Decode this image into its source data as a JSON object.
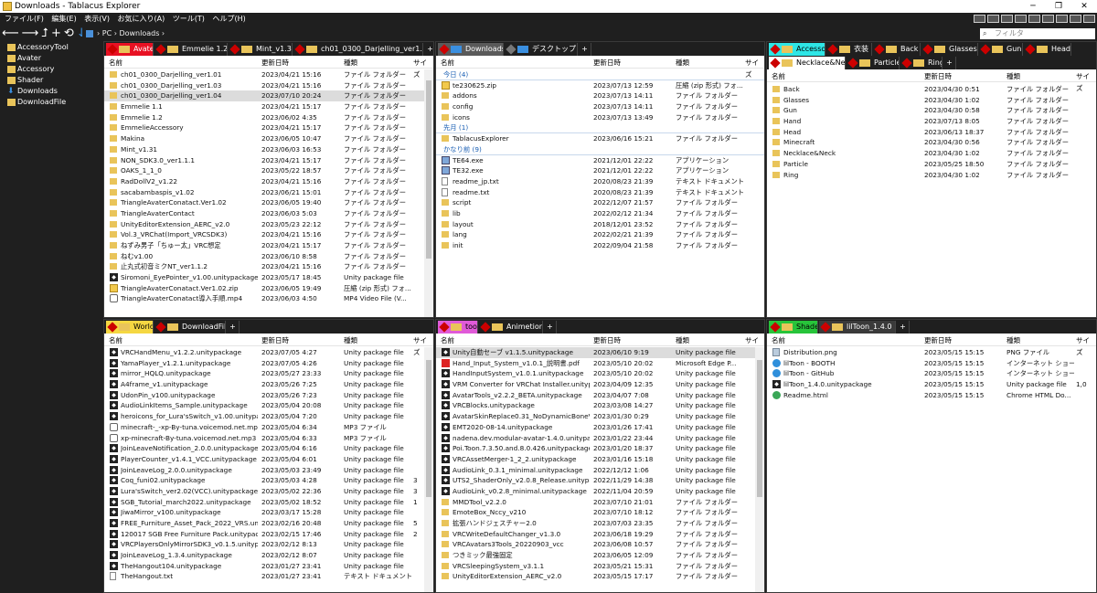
{
  "title": "Downloads - Tablacus Explorer",
  "window_buttons": [
    "─",
    "❐",
    "✕"
  ],
  "menu": [
    "ファイル(F)",
    "編集(E)",
    "表示(V)",
    "お気に入り(A)",
    "ツール(T)",
    "ヘルプ(H)"
  ],
  "address": "› PC › Downloads ›",
  "search_placeholder": "フィルタ",
  "sidebar": [
    "AccessoryTool",
    "Avater",
    "Accessory",
    "Shader",
    "Downloads",
    "DownloadFile"
  ],
  "columns": {
    "name": "名前",
    "date": "更新日時",
    "type": "種類",
    "size": "サイズ"
  },
  "panes": {
    "p1": {
      "tabs": [
        "Avater",
        "Emmelie 1.2",
        "Mint_v1.31",
        "ch01_0300_Darjelling_ver1.04",
        "+"
      ],
      "rows": [
        [
          "ch01_0300_Darjelling_ver1.01",
          "2023/04/21 15:16",
          "ファイル フォルダー",
          ""
        ],
        [
          "ch01_0300_Darjelling_ver1.03",
          "2023/04/21 15:16",
          "ファイル フォルダー",
          ""
        ],
        [
          "ch01_0300_Darjelling_ver1.04",
          "2023/07/10 20:24",
          "ファイル フォルダー",
          ""
        ],
        [
          "Emmelie 1.1",
          "2023/04/21 15:17",
          "ファイル フォルダー",
          ""
        ],
        [
          "Emmelie 1.2",
          "2023/06/02 4:35",
          "ファイル フォルダー",
          ""
        ],
        [
          "EmmelieAccessory",
          "2023/04/21 15:17",
          "ファイル フォルダー",
          ""
        ],
        [
          "Makina",
          "2023/06/05 10:47",
          "ファイル フォルダー",
          ""
        ],
        [
          "Mint_v1.31",
          "2023/06/03 16:53",
          "ファイル フォルダー",
          ""
        ],
        [
          "NON_SDK3.0_ver1.1.1",
          "2023/04/21 15:17",
          "ファイル フォルダー",
          ""
        ],
        [
          "OAKS_1_1_0",
          "2023/05/22 18:57",
          "ファイル フォルダー",
          ""
        ],
        [
          "RadDollV2_v1.22",
          "2023/04/21 15:16",
          "ファイル フォルダー",
          ""
        ],
        [
          "sacabambaspis_v1.02",
          "2023/06/21 15:01",
          "ファイル フォルダー",
          ""
        ],
        [
          "TriangleAvaterConatact.Ver1.02",
          "2023/06/05 19:40",
          "ファイル フォルダー",
          ""
        ],
        [
          "TriangleAvaterContact",
          "2023/06/03 5:03",
          "ファイル フォルダー",
          ""
        ],
        [
          "UnityEditorExtension_AERC_v2.0",
          "2023/05/23 22:12",
          "ファイル フォルダー",
          ""
        ],
        [
          "Vol.3_VRChat(Import_VRCSDK3)",
          "2023/04/21 15:16",
          "ファイル フォルダー",
          ""
        ],
        [
          "ねずみ男子「ちゅー太」VRC想定",
          "2023/04/21 15:17",
          "ファイル フォルダー",
          ""
        ],
        [
          "ねむv1.00",
          "2023/06/10 8:58",
          "ファイル フォルダー",
          ""
        ],
        [
          "止丸式初音ミクNT_ver1.1.2",
          "2023/04/21 15:16",
          "ファイル フォルダー",
          ""
        ],
        [
          "Siromoni_EyePointer_v1.00.unitypackage",
          "2023/05/17 18:45",
          "Unity package file",
          ""
        ],
        [
          "TriangleAvaterConatact.Ver1.02.zip",
          "2023/06/05 19:49",
          "圧縮 (zip 形式) フォ...",
          ""
        ],
        [
          "TriangleAvaterConatact導入手順.mp4",
          "2023/06/03 4:50",
          "MP4 Video File (V...",
          ""
        ]
      ]
    },
    "p2": {
      "tabs": [
        "Downloads",
        "デスクトップ",
        "+"
      ],
      "groups": [
        {
          "label": "今日 (4)",
          "rows": [
            [
              "te230625.zip",
              "2023/07/13 12:59",
              "圧縮 (zip 形式) フォ..."
            ],
            [
              "addons",
              "2023/07/13 14:11",
              "ファイル フォルダー"
            ],
            [
              "config",
              "2023/07/13 14:11",
              "ファイル フォルダー"
            ],
            [
              "icons",
              "2023/07/13 13:49",
              "ファイル フォルダー"
            ]
          ]
        },
        {
          "label": "先月 (1)",
          "rows": [
            [
              "TablacusExplorer",
              "2023/06/16 15:21",
              "ファイル フォルダー"
            ]
          ]
        },
        {
          "label": "かなり前 (9)",
          "rows": [
            [
              "TE64.exe",
              "2021/12/01 22:22",
              "アプリケーション"
            ],
            [
              "TE32.exe",
              "2021/12/01 22:22",
              "アプリケーション"
            ],
            [
              "readme_jp.txt",
              "2020/08/23 21:39",
              "テキスト ドキュメント"
            ],
            [
              "readme.txt",
              "2020/08/23 21:39",
              "テキスト ドキュメント"
            ],
            [
              "script",
              "2022/12/07 21:57",
              "ファイル フォルダー"
            ],
            [
              "lib",
              "2022/02/12 21:34",
              "ファイル フォルダー"
            ],
            [
              "layout",
              "2018/12/01 23:52",
              "ファイル フォルダー"
            ],
            [
              "lang",
              "2022/02/21 21:39",
              "ファイル フォルダー"
            ],
            [
              "init",
              "2022/09/04 21:58",
              "ファイル フォルダー"
            ]
          ]
        }
      ]
    },
    "p3": {
      "tabs": [
        "Accessory",
        "衣装",
        "Back",
        "Glasses",
        "Gun",
        "Head"
      ],
      "tabs2": [
        "Necklace&Neck",
        "Particle",
        "Ring",
        "+"
      ],
      "rows": [
        [
          "Back",
          "2023/04/30 0:51",
          "ファイル フォルダー"
        ],
        [
          "Glasses",
          "2023/04/30 1:02",
          "ファイル フォルダー"
        ],
        [
          "Gun",
          "2023/04/30 0:58",
          "ファイル フォルダー"
        ],
        [
          "Hand",
          "2023/07/13 8:05",
          "ファイル フォルダー"
        ],
        [
          "Head",
          "2023/06/13 18:37",
          "ファイル フォルダー"
        ],
        [
          "Minecraft",
          "2023/04/30 0:56",
          "ファイル フォルダー"
        ],
        [
          "Necklace&Neck",
          "2023/04/30 1:02",
          "ファイル フォルダー"
        ],
        [
          "Particle",
          "2023/05/25 18:50",
          "ファイル フォルダー"
        ],
        [
          "Ring",
          "2023/04/30 1:02",
          "ファイル フォルダー"
        ]
      ]
    },
    "p4": {
      "tabs": [
        "World",
        "DownloadFile",
        "+"
      ],
      "rows": [
        [
          "VRCHandMenu_v1.2.2.unitypackage",
          "2023/07/05 4:27",
          "Unity package file",
          ""
        ],
        [
          "YamaPlayer_v1.2.1.unitypackage",
          "2023/07/05 4:26",
          "Unity package file",
          ""
        ],
        [
          "mirror_HQLQ.unitypackage",
          "2023/05/27 23:33",
          "Unity package file",
          ""
        ],
        [
          "A4frame_v1.unitypackage",
          "2023/05/26 7:25",
          "Unity package file",
          ""
        ],
        [
          "UdonPin_v100.unitypackage",
          "2023/05/26 7:23",
          "Unity package file",
          ""
        ],
        [
          "AudioLinkItems_Sample.unitypackage",
          "2023/05/04 20:08",
          "Unity package file",
          ""
        ],
        [
          "heroicons_for_Lura'sSwitch_v1.00.unitypackage",
          "2023/05/04 7:20",
          "Unity package file",
          ""
        ],
        [
          "minecraft-_-xp-By-tuna.voicemod.net.mp3",
          "2023/05/04 6:34",
          "MP3 ファイル",
          ""
        ],
        [
          "xp-minecraft-By-tuna.voicemod.net.mp3",
          "2023/05/04 6:33",
          "MP3 ファイル",
          ""
        ],
        [
          "JoinLeaveNotification_2.0.0.unitypackage",
          "2023/05/04 6:16",
          "Unity package file",
          ""
        ],
        [
          "PlayerCounter_v1.4.1_VCC.unitypackage",
          "2023/05/04 6:01",
          "Unity package file",
          ""
        ],
        [
          "JoinLeaveLog_2.0.0.unitypackage",
          "2023/05/03 23:49",
          "Unity package file",
          ""
        ],
        [
          "Coq_funi02.unitypackage",
          "2023/05/03 4:28",
          "Unity package file",
          "3"
        ],
        [
          "Lura'sSwitch_ver2.02(VCC).unitypackage",
          "2023/05/02 22:36",
          "Unity package file",
          "3"
        ],
        [
          "SGB_Tutorial_march2022.unitypackage",
          "2023/05/02 18:52",
          "Unity package file",
          "1"
        ],
        [
          "JiwaMirror_v100.unitypackage",
          "2023/03/17 15:28",
          "Unity package file",
          ""
        ],
        [
          "FREE_Furniture_Asset_Pack_2022_VRS.unitypa...",
          "2023/02/16 20:48",
          "Unity package file",
          "5"
        ],
        [
          "120017 SGB Free Furniture Pack.unitypackage",
          "2023/02/15 17:46",
          "Unity package file",
          "2"
        ],
        [
          "VRCPlayersOnlyMirrorSDK3_v0.1.5.unitypack...",
          "2023/02/12 8:13",
          "Unity package file",
          ""
        ],
        [
          "JoinLeaveLog_1.3.4.unitypackage",
          "2023/02/12 8:07",
          "Unity package file",
          ""
        ],
        [
          "TheHangout104.unitypackage",
          "2023/01/27 23:41",
          "Unity package file",
          ""
        ],
        [
          "TheHangout.txt",
          "2023/01/27 23:41",
          "テキスト ドキュメント",
          ""
        ]
      ]
    },
    "p5": {
      "tabs": [
        "tool",
        "Animetion",
        "+"
      ],
      "rows": [
        [
          "Unity自動セーブ v1.1.5.unitypackage",
          "2023/06/10 9:19",
          "Unity package file"
        ],
        [
          "Hand_Input_System_v1.0.1_説明書.pdf",
          "2023/05/10 20:02",
          "Microsoft Edge P..."
        ],
        [
          "HandInputSystem_v1.0.1.unitypackage",
          "2023/05/10 20:02",
          "Unity package file"
        ],
        [
          "VRM Converter for VRChat Installer.unitypac...",
          "2023/04/09 12:35",
          "Unity package file"
        ],
        [
          "AvatarTools_v2.2.2_BETA.unitypackage",
          "2023/04/07 7:08",
          "Unity package file"
        ],
        [
          "VRCBlocks.unitypackage",
          "2023/03/08 14:27",
          "Unity package file"
        ],
        [
          "AvatarSkinReplace0.31_NoDynamicBoneVers...",
          "2023/01/30 0:29",
          "Unity package file"
        ],
        [
          "EMT2020-08-14.unitypackage",
          "2023/01/26 17:41",
          "Unity package file"
        ],
        [
          "nadena.dev.modular-avatar-1.4.0.unitypack...",
          "2023/01/22 23:44",
          "Unity package file"
        ],
        [
          "Poi.Toon.7.3.50.and.8.0.426.unitypackage",
          "2023/01/20 18:37",
          "Unity package file"
        ],
        [
          "VRCAssetMerger-1_2_2.unitypackage",
          "2023/01/16 15:18",
          "Unity package file"
        ],
        [
          "AudioLink_0.3.1_minimal.unitypackage",
          "2022/12/12 1:06",
          "Unity package file"
        ],
        [
          "UTS2_ShaderOnly_v2.0.8_Release.unitypacka...",
          "2022/11/29 14:38",
          "Unity package file"
        ],
        [
          "AudioLink_v0.2.8_minimal.unitypackage",
          "2022/11/04 20:59",
          "Unity package file"
        ],
        [
          "MMDTool_v2.2.0",
          "2023/07/10 21:01",
          "ファイル フォルダー"
        ],
        [
          "EmoteBox_Nccy_v210",
          "2023/07/10 18:12",
          "ファイル フォルダー"
        ],
        [
          "拡張ハンドジェスチャー2.0",
          "2023/07/03 23:35",
          "ファイル フォルダー"
        ],
        [
          "VRCWriteDefaultChanger_v1.3.0",
          "2023/06/18 19:29",
          "ファイル フォルダー"
        ],
        [
          "VRCAvatars3Tools_20220903_vcc",
          "2023/06/08 10:57",
          "ファイル フォルダー"
        ],
        [
          "つきミック最強固定",
          "2023/06/05 12:09",
          "ファイル フォルダー"
        ],
        [
          "VRCSleepingSystem_v3.1.1",
          "2023/05/21 15:31",
          "ファイル フォルダー"
        ],
        [
          "UnityEditorExtension_AERC_v2.0",
          "2023/05/15 17:17",
          "ファイル フォルダー"
        ]
      ]
    },
    "p6": {
      "tabs": [
        "Shader",
        "lilToon_1.4.0",
        "+"
      ],
      "rows": [
        [
          "Distribution.png",
          "2023/05/15 15:15",
          "PNG ファイル",
          ""
        ],
        [
          "lilToon - BOOTH",
          "2023/05/15 15:15",
          "インターネット ショート...",
          ""
        ],
        [
          "lilToon - GitHub",
          "2023/05/15 15:15",
          "インターネット ショート...",
          ""
        ],
        [
          "lilToon_1.4.0.unitypackage",
          "2023/05/15 15:15",
          "Unity package file",
          "1,0"
        ],
        [
          "Readme.html",
          "2023/05/15 15:15",
          "Chrome HTML Do...",
          ""
        ]
      ]
    }
  },
  "colors": {
    "accent_red": "#e81123",
    "tab_cyan": "#2ee6e6",
    "tab_green": "#27c43a",
    "tab_pink": "#e05ad8",
    "folder": "#e9c45a"
  }
}
